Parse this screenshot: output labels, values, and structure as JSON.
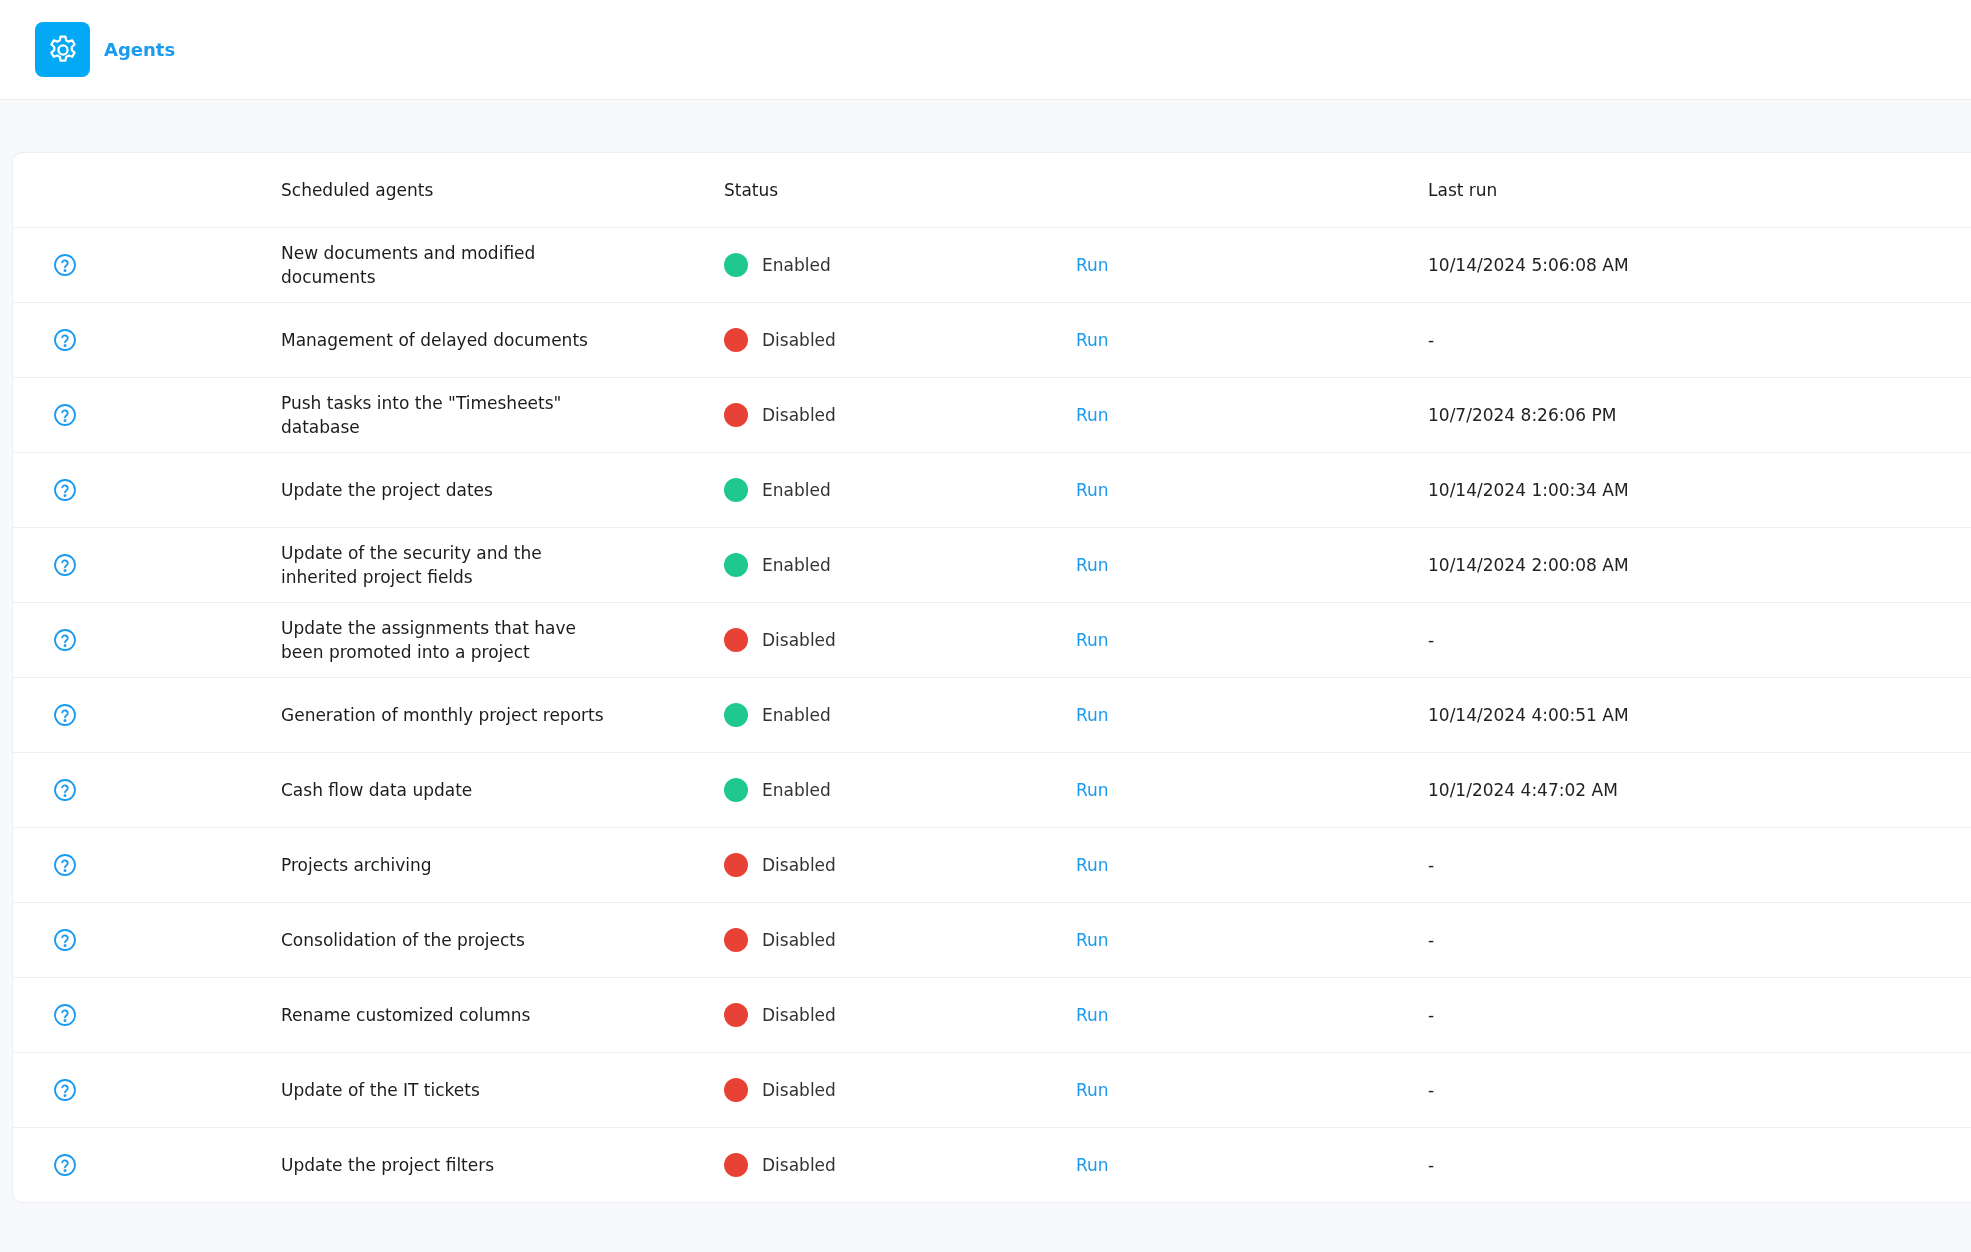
{
  "header": {
    "title": "Agents"
  },
  "table": {
    "columns": [
      "Scheduled agents",
      "Status",
      "Last run"
    ],
    "rows": [
      {
        "name": "New documents and modified documents",
        "status": "Enabled",
        "color": "#1fc98e",
        "action": "Run",
        "last_run": "10/14/2024 5:06:08 AM"
      },
      {
        "name": "Management of delayed documents",
        "status": "Disabled",
        "color": "#e84135",
        "action": "Run",
        "last_run": "-"
      },
      {
        "name": "Push tasks into the \"Timesheets\" database",
        "status": "Disabled",
        "color": "#e84135",
        "action": "Run",
        "last_run": "10/7/2024 8:26:06 PM"
      },
      {
        "name": "Update the project dates",
        "status": "Enabled",
        "color": "#1fc98e",
        "action": "Run",
        "last_run": "10/14/2024 1:00:34 AM"
      },
      {
        "name": "Update of the security and the inherited project fields",
        "status": "Enabled",
        "color": "#1fc98e",
        "action": "Run",
        "last_run": "10/14/2024 2:00:08 AM"
      },
      {
        "name": "Update the assignments that have been promoted into a project",
        "status": "Disabled",
        "color": "#e84135",
        "action": "Run",
        "last_run": "-"
      },
      {
        "name": "Generation of monthly project reports",
        "status": "Enabled",
        "color": "#1fc98e",
        "action": "Run",
        "last_run": "10/14/2024 4:00:51 AM"
      },
      {
        "name": "Cash flow data update",
        "status": "Enabled",
        "color": "#1fc98e",
        "action": "Run",
        "last_run": "10/1/2024 4:47:02 AM"
      },
      {
        "name": "Projects archiving",
        "status": "Disabled",
        "color": "#e84135",
        "action": "Run",
        "last_run": "-"
      },
      {
        "name": "Consolidation of the projects",
        "status": "Disabled",
        "color": "#e84135",
        "action": "Run",
        "last_run": "-"
      },
      {
        "name": "Rename customized columns",
        "status": "Disabled",
        "color": "#e84135",
        "action": "Run",
        "last_run": "-"
      },
      {
        "name": "Update of the IT tickets",
        "status": "Disabled",
        "color": "#e84135",
        "action": "Run",
        "last_run": "-"
      },
      {
        "name": "Update the project filters",
        "status": "Disabled",
        "color": "#e84135",
        "action": "Run",
        "last_run": "-"
      }
    ]
  }
}
